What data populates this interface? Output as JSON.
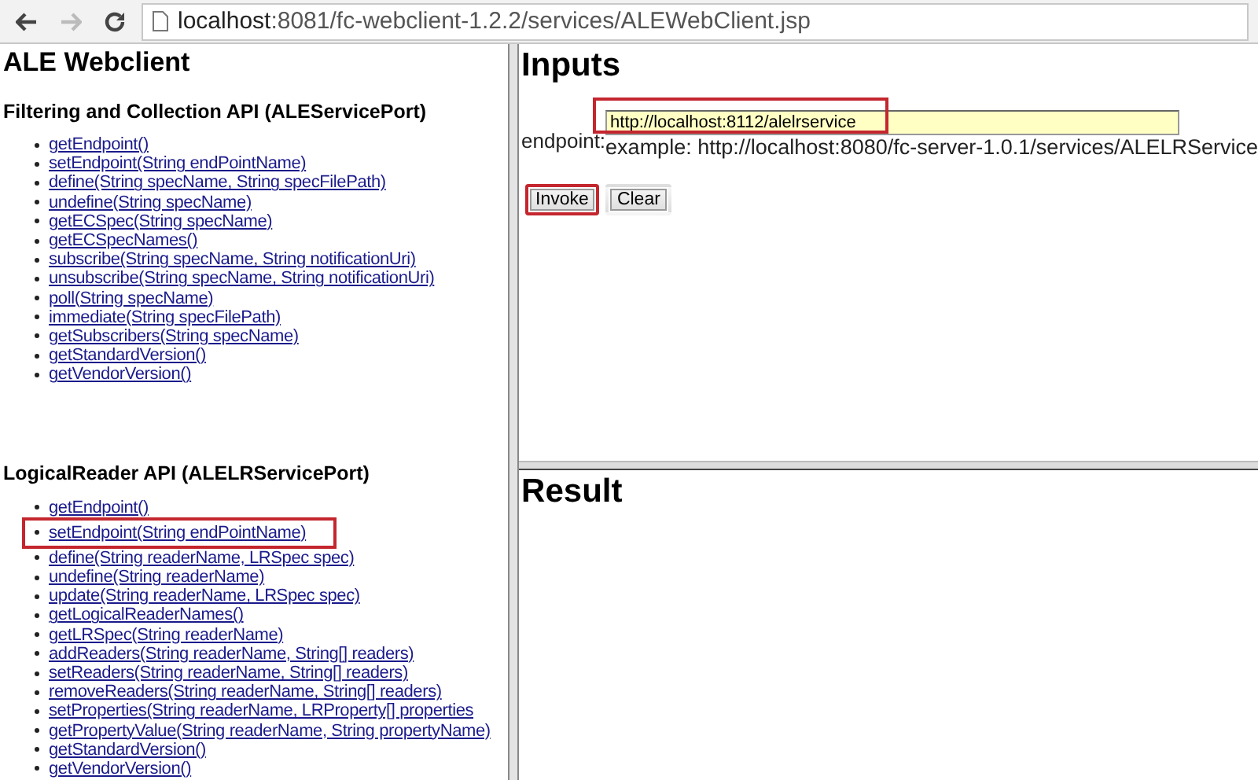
{
  "browser": {
    "url_host": "localhost",
    "url_rest": ":8081/fc-webclient-1.2.2/services/ALEWebClient.jsp"
  },
  "left_frame": {
    "title": "ALE Webclient",
    "sections": [
      {
        "heading": "Filtering and Collection API (ALEServicePort)",
        "links": [
          {
            "label": "getEndpoint()",
            "highlighted": false
          },
          {
            "label": "setEndpoint(String endPointName)",
            "highlighted": false
          },
          {
            "label": "define(String specName, String specFilePath)",
            "highlighted": false
          },
          {
            "label": "undefine(String specName)",
            "highlighted": false
          },
          {
            "label": "getECSpec(String specName)",
            "highlighted": false
          },
          {
            "label": "getECSpecNames()",
            "highlighted": false
          },
          {
            "label": "subscribe(String specName, String notificationUri)",
            "highlighted": false
          },
          {
            "label": "unsubscribe(String specName, String notificationUri)",
            "highlighted": false
          },
          {
            "label": "poll(String specName)",
            "highlighted": false
          },
          {
            "label": "immediate(String specFilePath)",
            "highlighted": false
          },
          {
            "label": "getSubscribers(String specName)",
            "highlighted": false
          },
          {
            "label": "getStandardVersion()",
            "highlighted": false
          },
          {
            "label": "getVendorVersion()",
            "highlighted": false
          }
        ]
      },
      {
        "heading": "LogicalReader API (ALELRServicePort)",
        "links": [
          {
            "label": "getEndpoint()",
            "highlighted": false
          },
          {
            "label": "setEndpoint(String endPointName)",
            "highlighted": true
          },
          {
            "label": "define(String readerName, LRSpec spec)",
            "highlighted": false
          },
          {
            "label": "undefine(String readerName)",
            "highlighted": false
          },
          {
            "label": "update(String readerName, LRSpec spec)",
            "highlighted": false
          },
          {
            "label": "getLogicalReaderNames()",
            "highlighted": false
          },
          {
            "label": "getLRSpec(String readerName)",
            "highlighted": false
          },
          {
            "label": "addReaders(String readerName, String[] readers)",
            "highlighted": false
          },
          {
            "label": "setReaders(String readerName, String[] readers)",
            "highlighted": false
          },
          {
            "label": "removeReaders(String readerName, String[] readers)",
            "highlighted": false
          },
          {
            "label": "setProperties(String readerName, LRProperty[] properties",
            "highlighted": false
          },
          {
            "label": "getPropertyValue(String readerName, String propertyName)",
            "highlighted": false
          },
          {
            "label": "getStandardVersion()",
            "highlighted": false
          },
          {
            "label": "getVendorVersion()",
            "highlighted": false
          }
        ]
      }
    ]
  },
  "inputs": {
    "title": "Inputs",
    "field_label": "endpoint:",
    "field_value": "http://localhost:8112/alelrservice",
    "field_highlighted": true,
    "example": "example: http://localhost:8080/fc-server-1.0.1/services/ALELRService",
    "buttons": [
      {
        "label": "Invoke",
        "highlighted": true
      },
      {
        "label": "Clear",
        "highlighted": false
      }
    ]
  },
  "result": {
    "title": "Result"
  }
}
